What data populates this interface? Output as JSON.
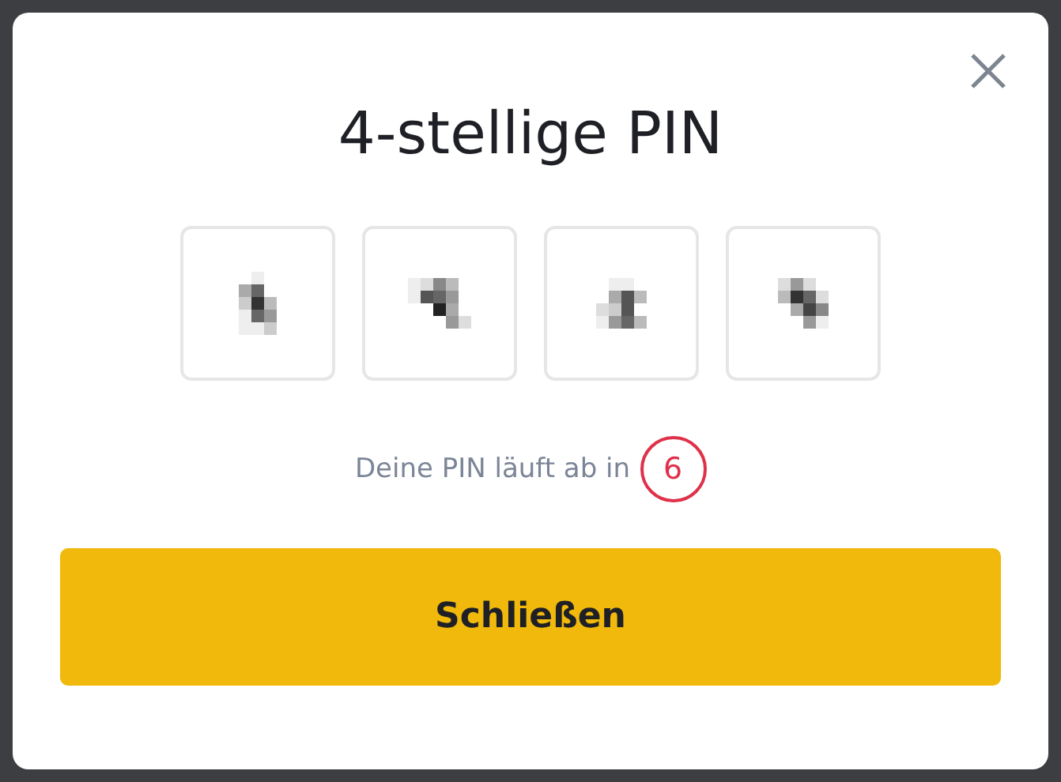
{
  "dialog": {
    "title": "4-stellige PIN",
    "pin_fields": [
      {
        "kind": "pixelated"
      },
      {
        "kind": "pixelated"
      },
      {
        "kind": "pixelated"
      },
      {
        "kind": "pixelated"
      }
    ],
    "expiry_text": "Deine PIN läuft ab in",
    "countdown": "6",
    "button": "Schließen"
  }
}
